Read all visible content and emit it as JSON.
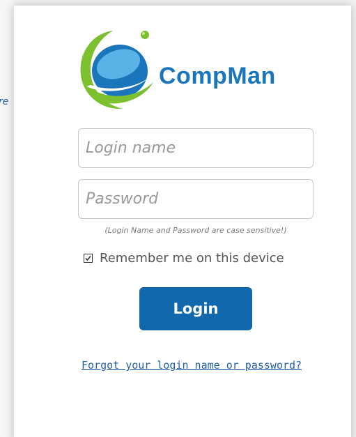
{
  "background": {
    "cutoff_text": "re"
  },
  "logo": {
    "brand_name": "CompMan",
    "colors": {
      "green": "#7cbf2f",
      "blue": "#1a75bb",
      "light_blue": "#5bb2e6"
    }
  },
  "form": {
    "login_placeholder": "Login name",
    "login_value": "",
    "password_placeholder": "Password",
    "password_value": "",
    "hint": "(Login Name and Password are case sensitive!)",
    "remember_label": "Remember me on this device",
    "remember_checked": true,
    "login_button": "Login",
    "forgot_link": "Forgot your login name or password?"
  },
  "colors": {
    "accent": "#1168ad",
    "link": "#1f5fa8"
  }
}
